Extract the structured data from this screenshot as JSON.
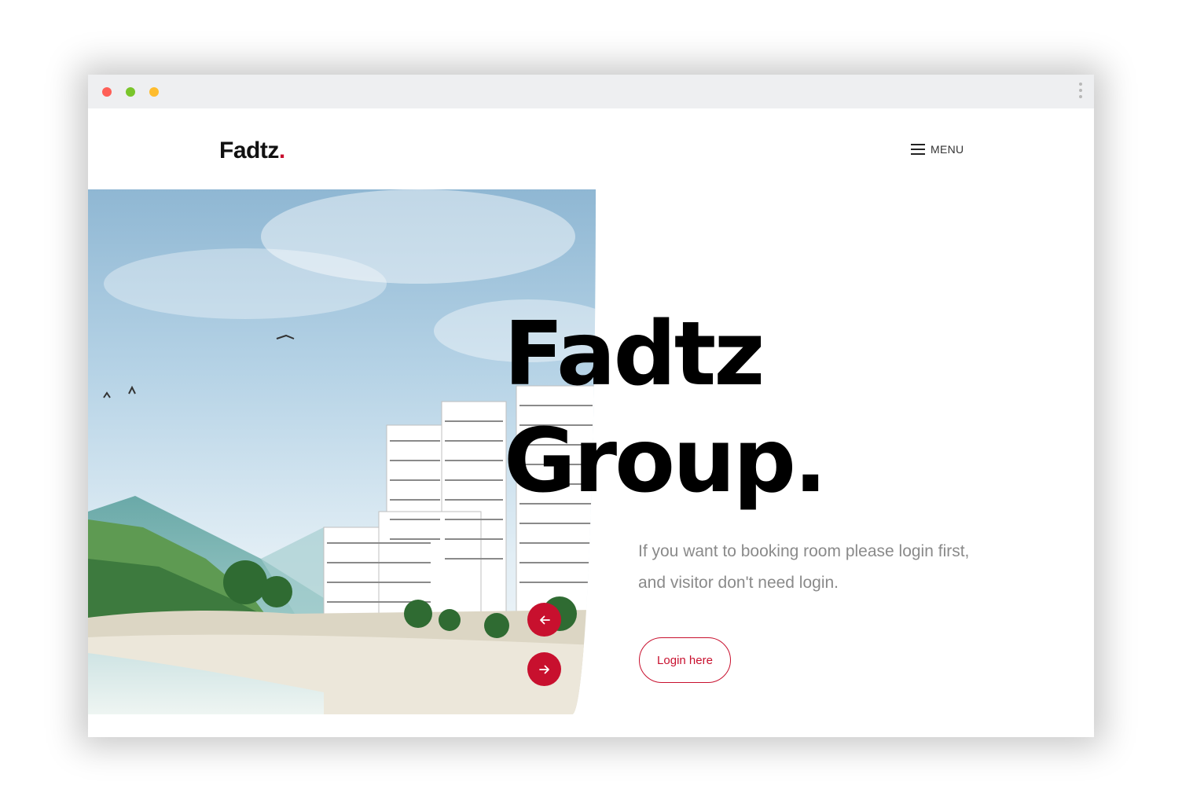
{
  "header": {
    "logo_text": "Fadtz",
    "logo_dot": ".",
    "menu_label": "MENU"
  },
  "hero": {
    "title_line1": "Fadtz",
    "title_line2": "Group.",
    "description": "If you want to booking room please login first, and visitor don't need login.",
    "login_button": "Login here"
  },
  "slider": {
    "prev_icon": "arrow-left-icon",
    "next_icon": "arrow-right-icon"
  },
  "colors": {
    "accent": "#c8102e",
    "text": "#000000",
    "muted": "#8a8a8a"
  }
}
